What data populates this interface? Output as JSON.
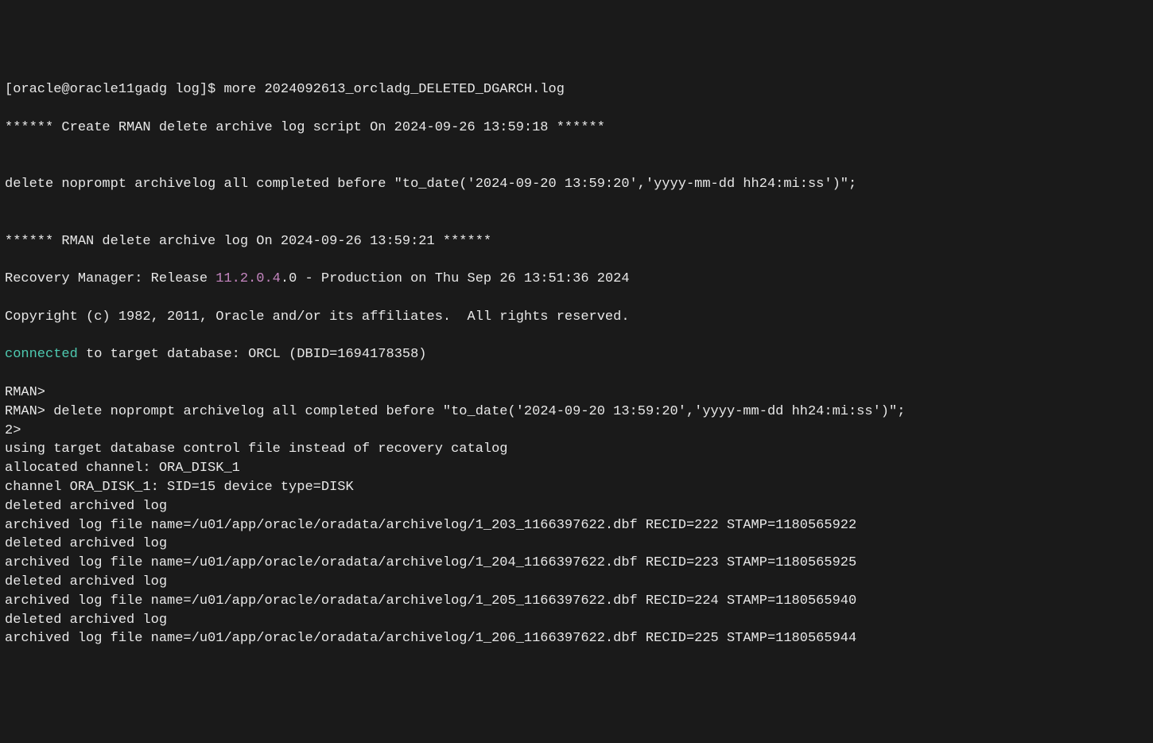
{
  "prompt": {
    "user_host": "[oracle@oracle11gadg log]$ ",
    "command": "more 2024092613_orcladg_DELETED_DGARCH.log"
  },
  "header1": "****** Create RMAN delete archive log script On 2024-09-26 13:59:18 ******",
  "delete_cmd": "delete noprompt archivelog all completed before \"to_date('2024-09-20 13:59:20','yyyy-mm-dd hh24:mi:ss')\";",
  "header2": "****** RMAN delete archive log On 2024-09-26 13:59:21 ******",
  "recovery_mgr_pre": "Recovery Manager: Release ",
  "version": "11.2.0.4",
  "recovery_mgr_post": ".0 - Production on Thu Sep 26 13:51:36 2024",
  "copyright": "Copyright (c) 1982, 2011, Oracle and/or its affiliates.  All rights reserved.",
  "connected_word": "connected",
  "connected_rest": " to target database: ORCL (DBID=1694178358)",
  "rman_prompt1": "RMAN> ",
  "rman_prompt2": "RMAN> ",
  "rman_delete_cmd": "delete noprompt archivelog all completed before \"to_date('2024-09-20 13:59:20','yyyy-mm-dd hh24:mi:ss')\";",
  "rman_prompt3": "2> ",
  "using_target": "using target database control file instead of recovery catalog",
  "allocated": "allocated channel: ORA_DISK_1",
  "channel_info": "channel ORA_DISK_1: SID=15 device type=DISK",
  "deleted1": "deleted archived log",
  "archived1": "archived log file name=/u01/app/oracle/oradata/archivelog/1_203_1166397622.dbf RECID=222 STAMP=1180565922",
  "deleted2": "deleted archived log",
  "archived2": "archived log file name=/u01/app/oracle/oradata/archivelog/1_204_1166397622.dbf RECID=223 STAMP=1180565925",
  "deleted3": "deleted archived log",
  "archived3": "archived log file name=/u01/app/oracle/oradata/archivelog/1_205_1166397622.dbf RECID=224 STAMP=1180565940",
  "deleted4": "deleted archived log",
  "archived4": "archived log file name=/u01/app/oracle/oradata/archivelog/1_206_1166397622.dbf RECID=225 STAMP=1180565944"
}
